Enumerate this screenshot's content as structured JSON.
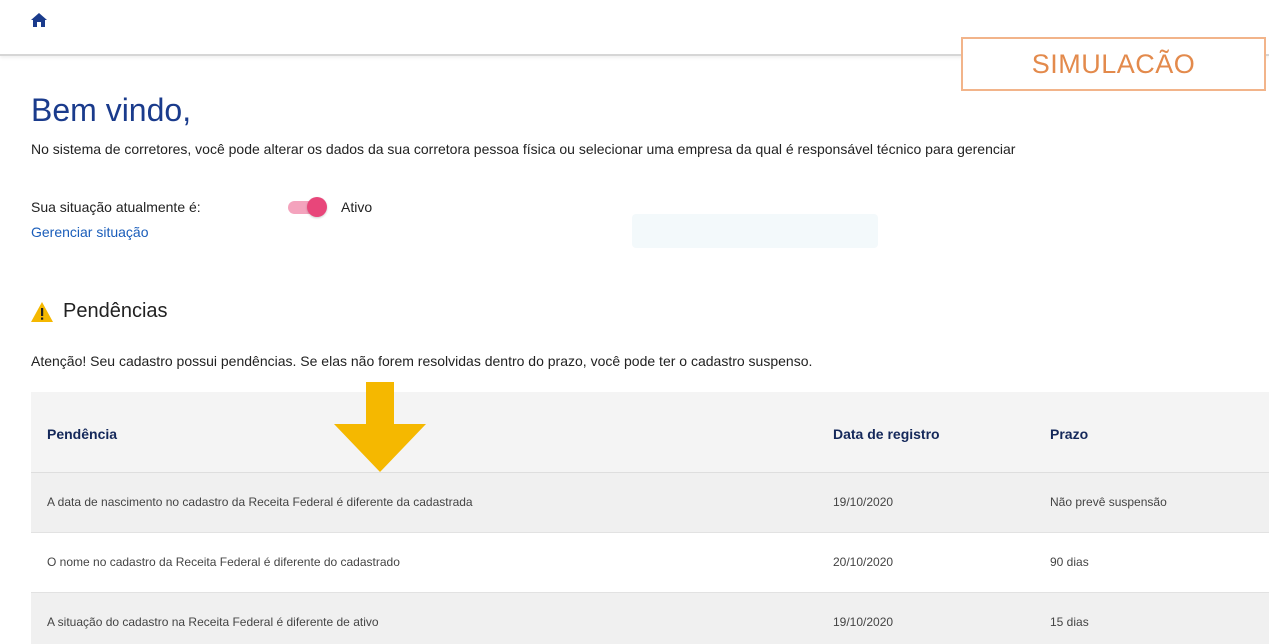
{
  "header": {
    "home_icon": "home-icon",
    "simulation_label": "SIMULACÃO"
  },
  "welcome": {
    "title": "Bem vindo,",
    "intro": "No sistema de corretores, você pode alterar os dados da sua corretora pessoa física ou selecionar uma empresa da qual é responsável técnico para gerenciar"
  },
  "status": {
    "label": "Sua situação atualmente é:",
    "value": "Ativo",
    "toggle_on": true,
    "manage_link": "Gerenciar situação"
  },
  "pendencias": {
    "icon": "warning-icon",
    "title": "Pendências",
    "attention": "Atenção! Seu cadastro possui pendências. Se elas não forem resolvidas dentro do prazo, você pode ter o cadastro suspenso.",
    "table": {
      "headers": [
        "Pendência",
        "Data de registro",
        "Prazo"
      ],
      "rows": [
        [
          "A data de nascimento no cadastro da Receita Federal é diferente da cadastrada",
          "19/10/2020",
          "Não prevê suspensão"
        ],
        [
          "O nome no cadastro da Receita Federal é diferente do cadastrado",
          "20/10/2020",
          "90 dias"
        ],
        [
          "A situação do cadastro na Receita Federal é diferente de ativo",
          "19/10/2020",
          "15 dias"
        ]
      ]
    }
  },
  "colors": {
    "title_blue": "#1a3b8c",
    "link_blue": "#1a5dba",
    "toggle_pink": "#e8467a",
    "warning_yellow": "#f5b800",
    "simulation_orange": "#e38a4c"
  }
}
